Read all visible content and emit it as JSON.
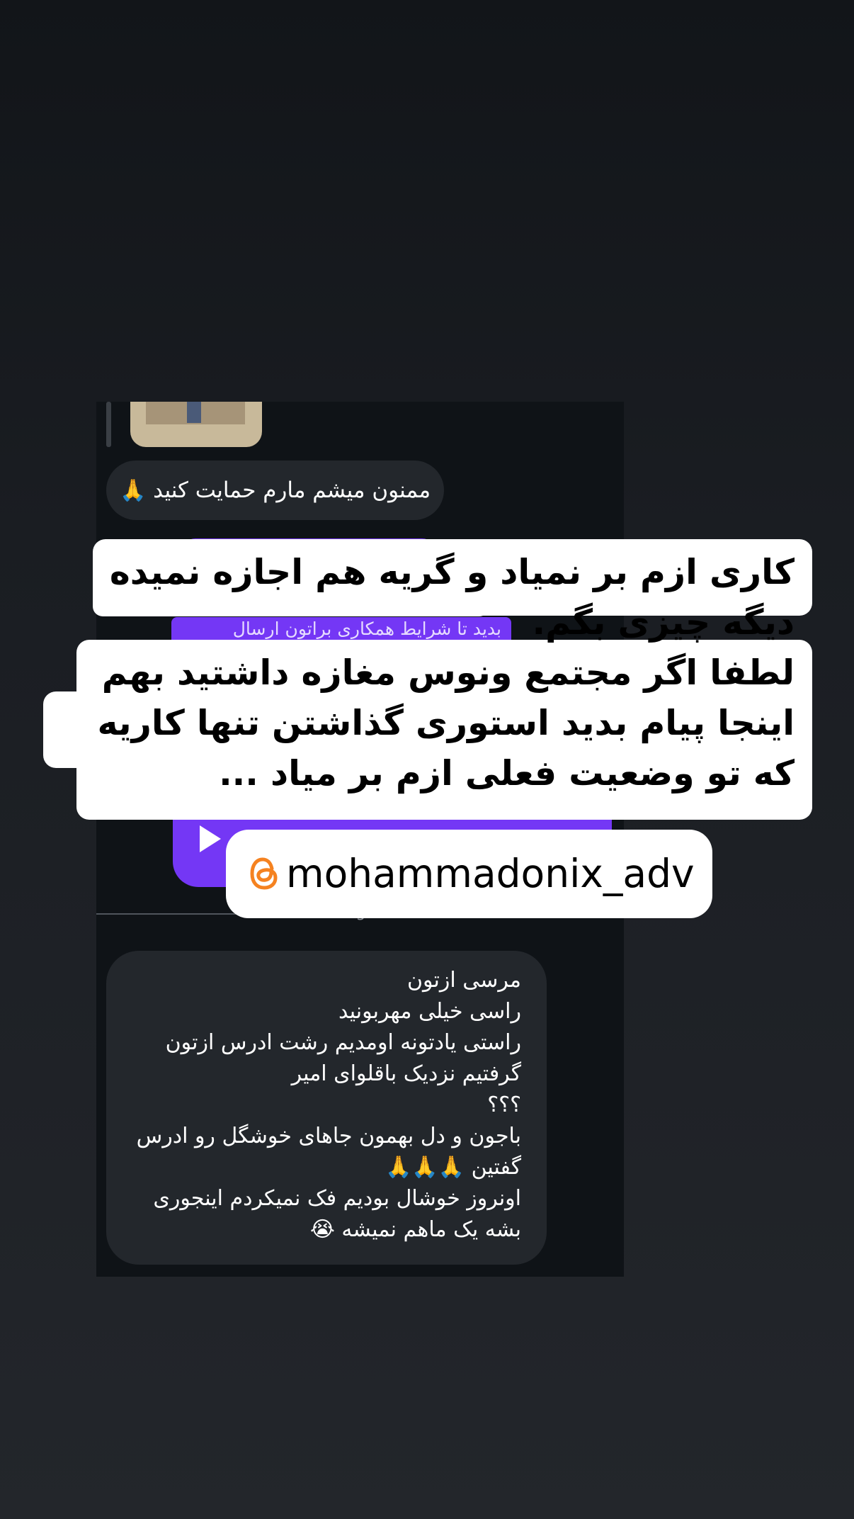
{
  "chat": {
    "message_1": "ممنون میشم مارم حمایت کنید",
    "message_1_emoji": "🙏",
    "partial_purple_text": "بدید تا شرایط همکاری براتون ارسال",
    "new_messages_label": "New messages",
    "message_2_lines": [
      "مرسی ازتون",
      "راسی خیلی مهربونید",
      "راستی یادتونه اومدیم رشت ادرس ازتون",
      "گرفتیم  نزدیک باقلوای امیر",
      "؟؟؟",
      "باجون و دل بهمون جاهای خوشگل رو ادرس",
      "گفتین 🙏🙏🙏",
      "اونروز خوشال بودیم فک نمیکردم اینجوری",
      "بشه یک ماهم نمیشه 😭"
    ]
  },
  "overlay": {
    "lines": [
      "کاری ازم بر نمیاد و گریه هم اجازه نمیده",
      "دیگه چیزی بگم.",
      "لطفا اگر مجتمع ونوس مغازه داشتید بهم",
      "اینجا پیام بدید استوری گذاشتن تنها کاریه",
      "که تو وضعیت فعلی ازم بر میاد ..."
    ],
    "handle": "mohammadonix_adv",
    "handle_icon": "threads-icon"
  },
  "colors": {
    "accent": "#7437f5",
    "threads_icon": "#f58220",
    "bubble": "#23272c",
    "chat_bg": "#0f1317"
  }
}
